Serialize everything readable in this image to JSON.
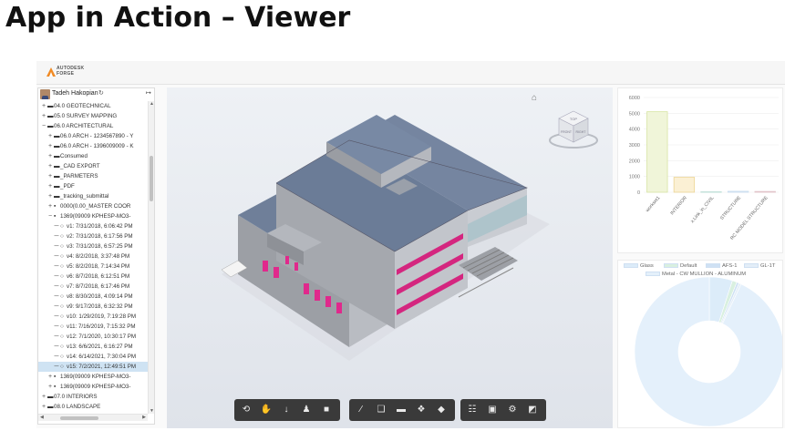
{
  "slide": {
    "title": "App in Action – Viewer"
  },
  "header": {
    "logo_line1": "AUTODESK",
    "logo_line2": "FORGE"
  },
  "tree": {
    "user_name": "Tadeh Hakopian",
    "refresh_glyph": "↻",
    "logout_glyph": "↦",
    "rows": [
      {
        "label": "04.0 GEOTECHNICAL",
        "glyph": "+",
        "icon": "folder-icon",
        "depth": 1
      },
      {
        "label": "05.0 SURVEY MAPPING",
        "glyph": "+",
        "icon": "folder-icon",
        "depth": 1
      },
      {
        "label": "06.0 ARCHITECTURAL",
        "glyph": "−",
        "icon": "folder-icon",
        "depth": 1
      },
      {
        "label": "06.0 ARCH - 1234567890 - Y",
        "glyph": "+",
        "icon": "folder-icon",
        "depth": 2
      },
      {
        "label": "06.0 ARCH - 1396009009 - K",
        "glyph": "+",
        "icon": "folder-icon",
        "depth": 2
      },
      {
        "label": "Consumed",
        "glyph": "+",
        "icon": "folder-icon",
        "depth": 2
      },
      {
        "label": "_CAD EXPORT",
        "glyph": "+",
        "icon": "folder-icon",
        "depth": 2
      },
      {
        "label": "_PARMETERS",
        "glyph": "+",
        "icon": "folder-icon",
        "depth": 2
      },
      {
        "label": "_PDF",
        "glyph": "+",
        "icon": "folder-icon",
        "depth": 2
      },
      {
        "label": "_tracking_submittal",
        "glyph": "+",
        "icon": "folder-icon",
        "depth": 2
      },
      {
        "label": "0000(0.00_MASTER COOR",
        "glyph": "+",
        "icon": "file-icon",
        "depth": 2
      },
      {
        "label": "1369(09009 KPHESP-MO3-",
        "glyph": "−",
        "icon": "file-icon",
        "depth": 2
      },
      {
        "label": "v1: 7/31/2018, 6:06:42 PM",
        "glyph": "",
        "icon": "version-icon",
        "depth": 3
      },
      {
        "label": "v2: 7/31/2018, 6:17:56 PM",
        "glyph": "",
        "icon": "version-icon",
        "depth": 3
      },
      {
        "label": "v3: 7/31/2018, 6:57:25 PM",
        "glyph": "",
        "icon": "version-icon",
        "depth": 3
      },
      {
        "label": "v4: 8/2/2018, 3:37:48 PM",
        "glyph": "",
        "icon": "version-icon",
        "depth": 3
      },
      {
        "label": "v5: 8/2/2018, 7:14:34 PM",
        "glyph": "",
        "icon": "version-icon",
        "depth": 3
      },
      {
        "label": "v6: 8/7/2018, 6:12:51 PM",
        "glyph": "",
        "icon": "version-icon",
        "depth": 3
      },
      {
        "label": "v7: 8/7/2018, 6:17:46 PM",
        "glyph": "",
        "icon": "version-icon",
        "depth": 3
      },
      {
        "label": "v8: 8/30/2018, 4:09:14 PM",
        "glyph": "",
        "icon": "version-icon",
        "depth": 3
      },
      {
        "label": "v9: 9/17/2018, 6:32:32 PM",
        "glyph": "",
        "icon": "version-icon",
        "depth": 3
      },
      {
        "label": "v10: 1/29/2019, 7:19:28 PM",
        "glyph": "",
        "icon": "version-icon",
        "depth": 3
      },
      {
        "label": "v11: 7/16/2019, 7:15:32 PM",
        "glyph": "",
        "icon": "version-icon",
        "depth": 3
      },
      {
        "label": "v12: 7/1/2020, 10:30:17 PM",
        "glyph": "",
        "icon": "version-icon",
        "depth": 3
      },
      {
        "label": "v13: 6/6/2021, 6:16:27 PM",
        "glyph": "",
        "icon": "version-icon",
        "depth": 3
      },
      {
        "label": "v14: 6/14/2021, 7:30:04 PM",
        "glyph": "",
        "icon": "version-icon",
        "depth": 3
      },
      {
        "label": "v15: 7/2/2021, 12:49:51 PM",
        "glyph": "",
        "icon": "version-icon",
        "depth": 3,
        "selected": true
      },
      {
        "label": "1369(09009 KPHESP-MO3-",
        "glyph": "+",
        "icon": "file-icon",
        "depth": 2
      },
      {
        "label": "1369(09009 KPHESP-MO3-",
        "glyph": "+",
        "icon": "file-icon",
        "depth": 2
      },
      {
        "label": "07.0 INTERIORS",
        "glyph": "+",
        "icon": "folder-icon",
        "depth": 1
      },
      {
        "label": "08.0 LANDSCAPE",
        "glyph": "+",
        "icon": "folder-icon",
        "depth": 1
      }
    ]
  },
  "viewer": {
    "home_glyph": "⌂",
    "cube_faces": {
      "top": "TOP",
      "front": "FRONT",
      "right": "RIGHT"
    },
    "toolbar": [
      {
        "name": "orbit-icon",
        "glyph": "⟲",
        "group": 0
      },
      {
        "name": "pan-icon",
        "glyph": "✋",
        "group": 0,
        "active": true
      },
      {
        "name": "zoom-icon",
        "glyph": "↓",
        "group": 0
      },
      {
        "name": "first-person-icon",
        "glyph": "♟",
        "group": 0
      },
      {
        "name": "camera-icon",
        "glyph": "■",
        "group": 0
      },
      {
        "name": "measure-icon",
        "glyph": "∕",
        "group": 1
      },
      {
        "name": "section-icon",
        "glyph": "❑",
        "group": 1
      },
      {
        "name": "explode-icon",
        "glyph": "▬",
        "group": 1
      },
      {
        "name": "model-browser-icon",
        "glyph": "❖",
        "group": 1
      },
      {
        "name": "properties-icon",
        "glyph": "◆",
        "group": 1
      },
      {
        "name": "structure-icon",
        "glyph": "☷",
        "group": 2
      },
      {
        "name": "save-icon",
        "glyph": "▣",
        "group": 2
      },
      {
        "name": "settings-icon",
        "glyph": "⚙",
        "group": 2
      },
      {
        "name": "fullscreen-icon",
        "glyph": "◩",
        "group": 2
      }
    ]
  },
  "chart_data": [
    {
      "type": "bar",
      "categories": [
        "workset1",
        "INTERIOR",
        "x.Link_in_CIVIL",
        "STRUCTURE",
        "RC MODEL STRUCTURE"
      ],
      "values": [
        5100,
        950,
        30,
        60,
        50
      ],
      "ylim": [
        0,
        6000
      ],
      "yticks": [
        "0",
        "1000",
        "2000",
        "3000",
        "4000",
        "5000",
        "6000"
      ],
      "colors": [
        "#f0f5d9",
        "#fbf0d4",
        "#e3f1ee",
        "#e8f1f8",
        "#f2e6e8"
      ],
      "borders": [
        "#d7e4a3",
        "#ecd595",
        "#bfe0d7",
        "#c7dcee",
        "#e0c2c7"
      ],
      "grid": true,
      "legend": "none"
    },
    {
      "type": "pie",
      "donut": true,
      "legend_position": "top",
      "series": [
        {
          "name": "Glass",
          "value": 5,
          "color": "#dcecf9"
        },
        {
          "name": "Default",
          "value": 1,
          "color": "#d9f0e0"
        },
        {
          "name": "AFS-1",
          "value": 0.5,
          "color": "#cfe1f4"
        },
        {
          "name": "GL-1T",
          "value": 0.5,
          "color": "#e3eef8"
        },
        {
          "name": "Metal - CW MULLION - ALUMINUM",
          "value": 93,
          "color": "#e4f0fb"
        }
      ]
    }
  ]
}
